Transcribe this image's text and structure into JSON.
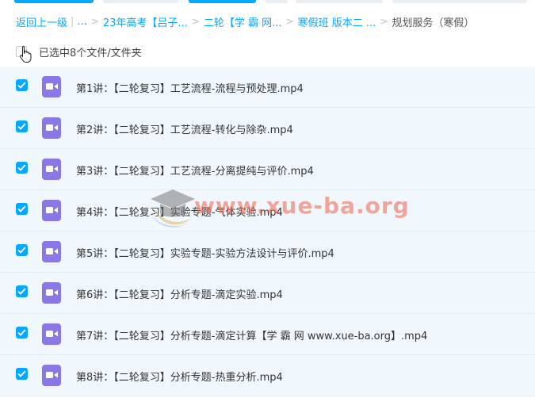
{
  "breadcrumb": {
    "back": "返回上一级",
    "ellipsis": "...",
    "items": [
      "23年高考【吕子...",
      "二轮【学 霸 网...",
      "寒假班 版本二 ..."
    ],
    "current": "规划服务（寒假）"
  },
  "selection": {
    "label": "已选中8个文件/文件夹"
  },
  "files": [
    {
      "name": "第1讲：【二轮复习】工艺流程-流程与预处理.mp4"
    },
    {
      "name": "第2讲：【二轮复习】工艺流程-转化与除杂.mp4"
    },
    {
      "name": "第3讲：【二轮复习】工艺流程-分离提纯与评价.mp4"
    },
    {
      "name": "第4讲：【二轮复习】实验专题-气体实验.mp4"
    },
    {
      "name": "第5讲：【二轮复习】实验专题-实验方法设计与评价.mp4"
    },
    {
      "name": "第6讲：【二轮复习】分析专题-滴定实验.mp4"
    },
    {
      "name": "第7讲：【二轮复习】分析专题-滴定计算【学 霸 网 www.xue-ba.org】.mp4"
    },
    {
      "name": "第8讲：【二轮复习】分析专题-热重分析.mp4"
    }
  ],
  "watermark": {
    "text": "www.xue-ba.org"
  },
  "colors": {
    "accent": "#06a7ff",
    "row_bg": "#f1f8fd",
    "video_icon": "#8b78e6"
  },
  "icons": {
    "file": "video-file-icon",
    "check": "checkbox-checked-icon",
    "cursor": "hand-pointer-icon"
  }
}
